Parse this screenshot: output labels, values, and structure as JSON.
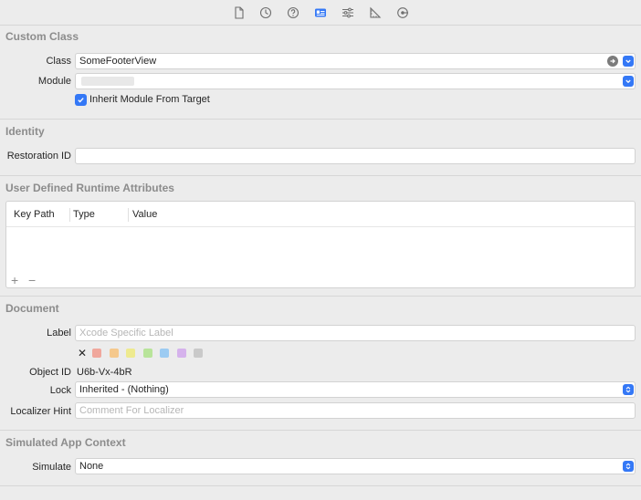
{
  "toolbar": {
    "icons": [
      "file-icon",
      "history-icon",
      "help-icon",
      "identity-inspector-icon",
      "attributes-icon",
      "size-ruler-icon",
      "connections-icon"
    ]
  },
  "custom_class": {
    "title": "Custom Class",
    "class_label": "Class",
    "class_value": "SomeFooterView",
    "module_label": "Module",
    "inherit_label": "Inherit Module From Target"
  },
  "identity": {
    "title": "Identity",
    "restoration_label": "Restoration ID",
    "restoration_value": ""
  },
  "runtime": {
    "title": "User Defined Runtime Attributes",
    "columns": [
      "Key Path",
      "Type",
      "Value"
    ],
    "add": "+",
    "remove": "−"
  },
  "document": {
    "title": "Document",
    "label_label": "Label",
    "label_placeholder": "Xcode Specific Label",
    "clear_mark": "✕",
    "swatch_colors": [
      "#f0a79c",
      "#f5c88c",
      "#eeea8f",
      "#b8e49a",
      "#9ccbf2",
      "#d5b2ec",
      "#c9c9c9"
    ],
    "object_id_label": "Object ID",
    "object_id_value": "U6b-Vx-4bR",
    "lock_label": "Lock",
    "lock_value": "Inherited - (Nothing)",
    "hint_label": "Localizer Hint",
    "hint_placeholder": "Comment For Localizer"
  },
  "simulated": {
    "title": "Simulated App Context",
    "simulate_label": "Simulate",
    "simulate_value": "None"
  },
  "colors": {
    "accent": "#3478f6",
    "section_title": "#8c8c8c",
    "background": "#ececec"
  }
}
